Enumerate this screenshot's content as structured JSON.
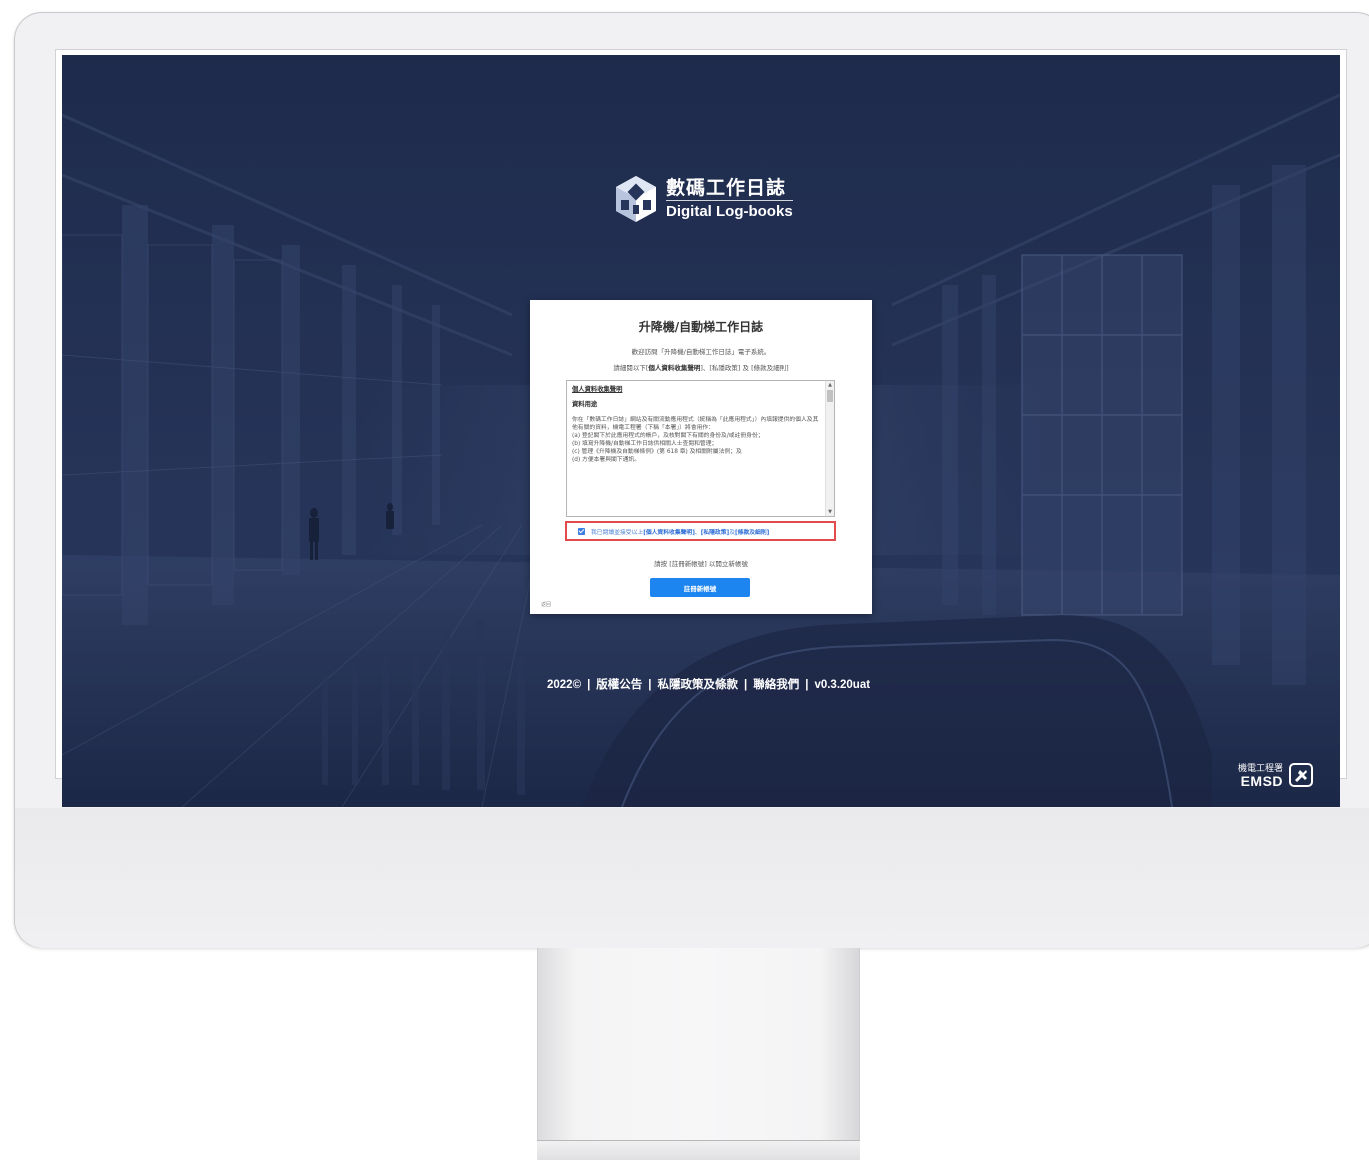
{
  "brand": {
    "name_cn": "數碼工作日誌",
    "name_en": "Digital Log-books",
    "icon": "cube-logo-icon"
  },
  "card": {
    "title": "升降機/自動梯工作日誌",
    "welcome": "歡迎訪問「升降機/自動梯工作日誌」電子系統。",
    "read_prefix": "請細閱以下[",
    "read_pics": "個人資料收集聲明",
    "read_mid": "]、[私隱政策] 及 [條款及細則]",
    "terms": {
      "heading": "個人資料收集聲明",
      "subheading": "資料用途",
      "paragraph": "你在「數碼工作日誌」網站及有關流動應用程式（統稱為「此應用程式」）內填報提供的個人及其他有關的資料，機電工程署（下稱「本署」）將會用作：",
      "item_a": "(a) 登記閣下於此應用程式的帳戶，及核對閣下有關的身份及/或註冊身份；",
      "item_b": "(b) 填寫升降機/自動梯工作日誌供相關人士查閱和管理；",
      "item_c": "(c) 管理《升降機及自動梯條例》(第 618 章) 及相關附屬法例；及",
      "item_d": "(d) 方便本署與閣下通訊。"
    },
    "agree_prefix": "我已閱讀並接受以上",
    "agree_pics": "[個人資料收集聲明]",
    "agree_mid": "、",
    "agree_privacy": "[私隱政策]",
    "agree_and": " 及 ",
    "agree_terms": "[條款及細則]",
    "agree_checked": true,
    "register_hint": "請按 [註冊新帳號] 以開立新帳號",
    "register_button": "註冊新帳號",
    "back_link": "返回"
  },
  "footer": {
    "year": "2022©",
    "copyright": "版權公告",
    "privacy": "私隱政策及條款",
    "contact": "聯絡我們",
    "version": "v0.3.20uat",
    "separator": "|"
  },
  "emsd": {
    "name_cn": "機電工程署",
    "name_en": "EMSD",
    "icon": "emsd-logo-icon"
  },
  "colors": {
    "screen_bg": "#27355a",
    "primary_button": "#1d85f0",
    "highlight_border": "#e14b4b",
    "link": "#2f6fd6"
  }
}
